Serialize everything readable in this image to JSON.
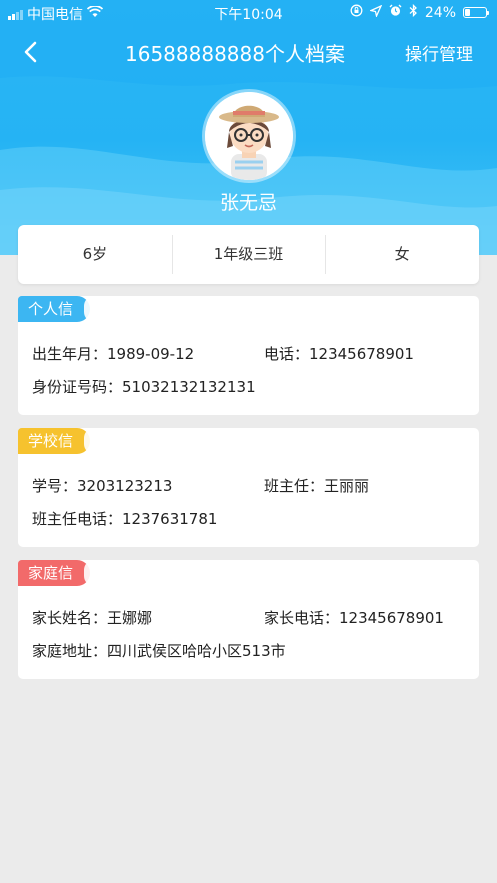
{
  "status_bar": {
    "carrier": "中国电信",
    "time": "下午10:04",
    "battery": "24%",
    "battery_level": 0.24
  },
  "nav": {
    "title": "16588888888个人档案",
    "action": "操行管理"
  },
  "profile": {
    "name": "张无忌",
    "age": "6岁",
    "class": "1年级三班",
    "gender": "女"
  },
  "personal": {
    "tag": "个人信息",
    "birth": "出生年月：1989-09-12",
    "phone": "电话：12345678901",
    "id_no": "身份证号码：51032132132131"
  },
  "school": {
    "tag": "学校信息",
    "student_no": "学号：3203123213",
    "teacher": "班主任：王丽丽",
    "teacher_phone": "班主任电话：1237631781"
  },
  "family": {
    "tag": "家庭信息",
    "parent_name": "家长姓名：王娜娜",
    "parent_phone": "家长电话：12345678901",
    "address": "家庭地址：四川武侯区哈哈小区513市"
  },
  "colors": {
    "header": "#2bb6f5",
    "personal_tag": "#3cb6f2",
    "school_tag": "#f6c22e",
    "family_tag": "#f26a6a"
  }
}
